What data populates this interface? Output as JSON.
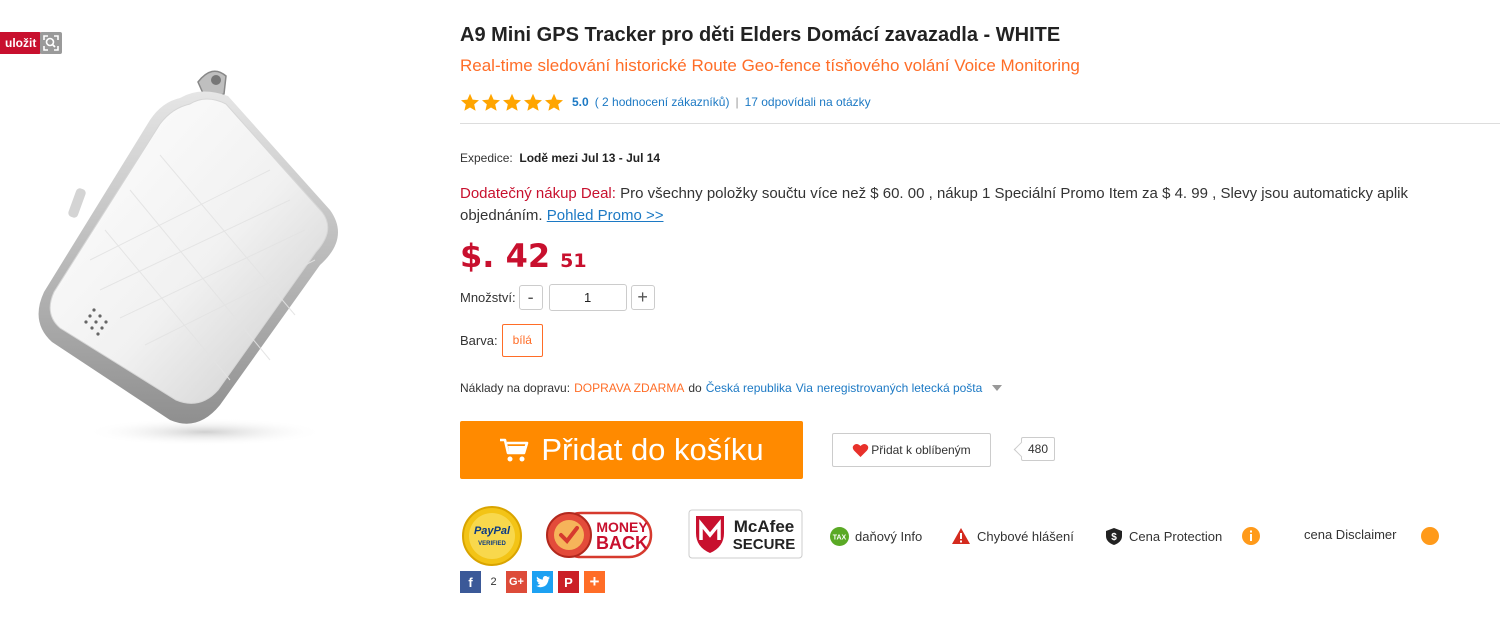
{
  "gallery": {
    "save_label": "uložit",
    "zoom_icon": "zoom-icon"
  },
  "product": {
    "title": "A9 Mini GPS Tracker pro děti Elders Domácí zavazadla  -  WHITE",
    "subtitle": "Real-time sledování historické Route Geo-fence tísňového volání Voice Monitoring",
    "rating": {
      "stars": 5,
      "value": "5.0",
      "reviews_link": "( 2 hodnocení zákazníků)",
      "separator": "|",
      "questions_link": "17 odpovídali na otázky"
    },
    "shipping_date": {
      "label": "Expedice:",
      "value": "Lodě mezi Jul 13 - Jul 14"
    },
    "deal": {
      "label": "Dodatečný nákup Deal:",
      "text": "Pro všechny položky součtu více než $ 60. 00 , nákup 1 Speciální Promo Item za $ 4. 99 , Slevy jsou automaticky aplik",
      "text2": "objednáním.",
      "link": "Pohled Promo >>"
    },
    "price": {
      "main": "$. 42",
      "cents": "51"
    },
    "quantity": {
      "label": "Množství:",
      "minus": "-",
      "value": "1",
      "plus": "+"
    },
    "color": {
      "label": "Barva:",
      "selected": "bílá",
      "accent": "#ff6d27"
    },
    "shipping": {
      "label": "Náklady na dopravu:",
      "free": "DOPRAVA ZDARMA",
      "to": "do",
      "country": "Česká republika",
      "via": "Via",
      "method": "neregistrovaných letecká pošta"
    },
    "cart_button": "Přidat do košíku",
    "favorite_button": "Přidat k oblíbeným",
    "favorite_count": "480"
  },
  "trust": {
    "paypal": {
      "line1": "PayPal",
      "line2": "VERIFIED"
    },
    "money_back": {
      "line1": "MONEY",
      "line2": "BACK"
    },
    "mcafee": {
      "line1": "McAfee",
      "line2": "SECURE"
    },
    "items": {
      "tax": "daňový Info",
      "tax_badge": "TAX",
      "error": "Chybové hlášení",
      "protection": "Cena Protection",
      "disclaimer": "cena Disclaimer"
    }
  },
  "social": {
    "facebook": "f",
    "facebook_count": "2",
    "google": "G+",
    "twitter_icon": "twitter-icon",
    "pinterest": "P",
    "more": "+"
  },
  "colors": {
    "brand_orange": "#ff8a00",
    "price_red": "#c8102e",
    "link_blue": "#1c79c4"
  }
}
